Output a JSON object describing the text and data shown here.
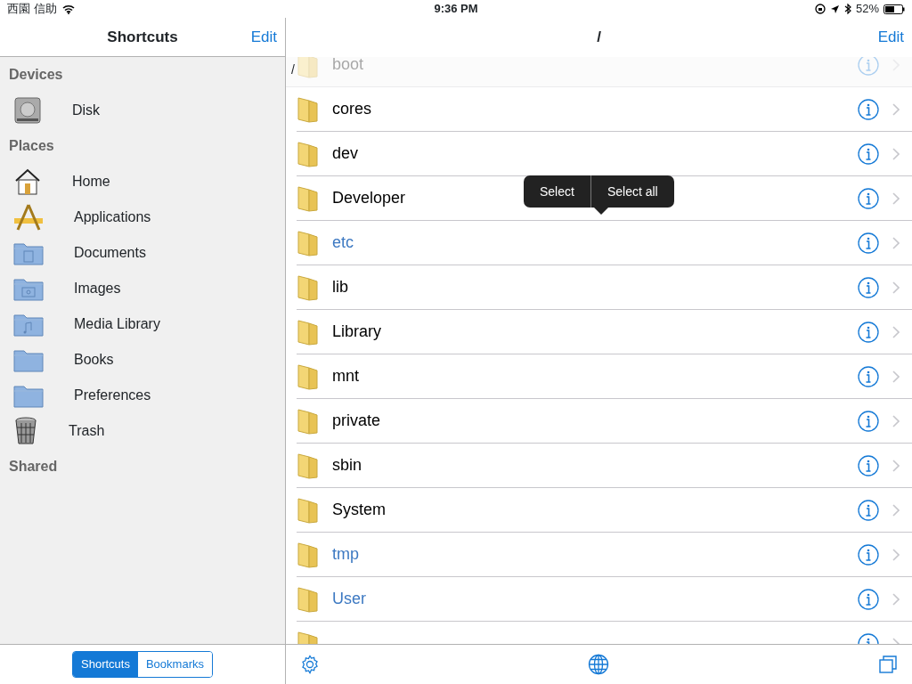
{
  "status_bar": {
    "carrier": "西園 信助",
    "time": "9:36 PM",
    "battery": "52%"
  },
  "sidebar": {
    "title": "Shortcuts",
    "edit": "Edit",
    "sections": [
      {
        "title": "Devices",
        "items": [
          {
            "label": "Disk",
            "kind": "disk"
          }
        ]
      },
      {
        "title": "Places",
        "items": [
          {
            "label": "Home",
            "kind": "home"
          },
          {
            "label": "Applications",
            "kind": "apps"
          },
          {
            "label": "Documents",
            "kind": "documents"
          },
          {
            "label": "Images",
            "kind": "images"
          },
          {
            "label": "Media Library",
            "kind": "music"
          },
          {
            "label": "Books",
            "kind": "folder"
          },
          {
            "label": "Preferences",
            "kind": "folder"
          },
          {
            "label": "Trash",
            "kind": "trash"
          }
        ]
      },
      {
        "title": "Shared"
      }
    ],
    "segments": [
      {
        "label": "Shortcuts",
        "selected": true
      },
      {
        "label": "Bookmarks",
        "selected": false
      }
    ]
  },
  "main": {
    "title": "/",
    "edit": "Edit",
    "path": "/",
    "rows": [
      {
        "name": "boot",
        "kind": "folder",
        "dimmed": true
      },
      {
        "name": "cores",
        "kind": "folder",
        "dimmed": false
      },
      {
        "name": "dev",
        "kind": "folder",
        "dimmed": false
      },
      {
        "name": "Developer",
        "kind": "folder",
        "dimmed": false
      },
      {
        "name": "etc",
        "kind": "symlink",
        "dimmed": false
      },
      {
        "name": "lib",
        "kind": "folder",
        "dimmed": false
      },
      {
        "name": "Library",
        "kind": "folder",
        "dimmed": false
      },
      {
        "name": "mnt",
        "kind": "folder",
        "dimmed": false
      },
      {
        "name": "private",
        "kind": "folder",
        "dimmed": false
      },
      {
        "name": "sbin",
        "kind": "folder",
        "dimmed": false
      },
      {
        "name": "System",
        "kind": "folder",
        "dimmed": false
      },
      {
        "name": "tmp",
        "kind": "symlink",
        "dimmed": false
      },
      {
        "name": "User",
        "kind": "symlink",
        "dimmed": false
      },
      {
        "dimmed": false
      }
    ],
    "menu": [
      "Select",
      "Select all"
    ]
  }
}
